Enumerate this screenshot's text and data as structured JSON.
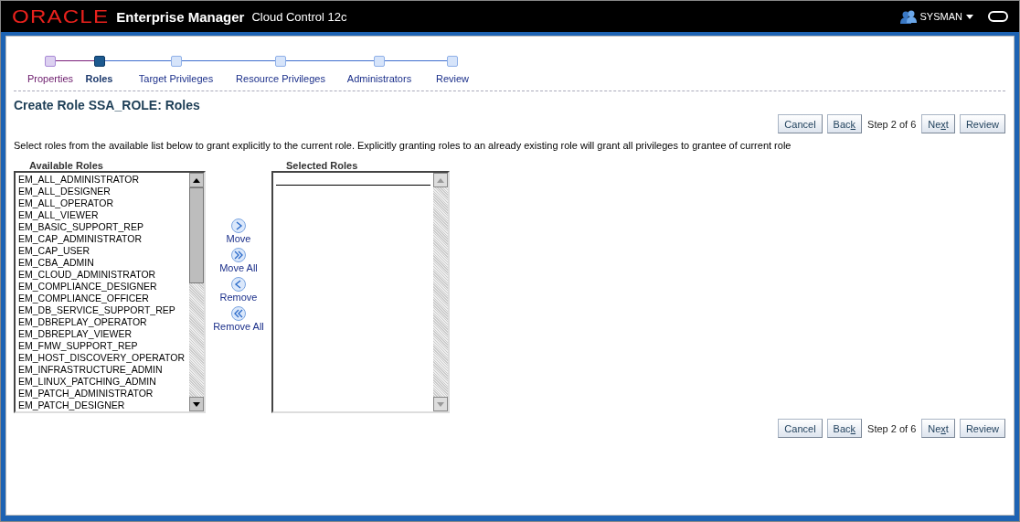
{
  "header": {
    "brand": "ORACLE",
    "product": "Enterprise Manager",
    "edition": "Cloud Control 12c",
    "user": "SYSMAN"
  },
  "train": [
    {
      "label": "Properties",
      "visited": true,
      "selected": false
    },
    {
      "label": "Roles",
      "visited": false,
      "selected": true
    },
    {
      "label": "Target Privileges",
      "visited": false,
      "selected": false
    },
    {
      "label": "Resource Privileges",
      "visited": false,
      "selected": false
    },
    {
      "label": "Administrators",
      "visited": false,
      "selected": false
    },
    {
      "label": "Review",
      "visited": false,
      "selected": false
    }
  ],
  "page_title": "Create Role SSA_ROLE: Roles",
  "top_nav": {
    "buttons": [
      {
        "before": "Cancel"
      },
      {
        "before": "Bac",
        "key": "k"
      }
    ],
    "step": "Step 2 of 6",
    "next_buttons": [
      {
        "before": "Ne",
        "key": "x",
        "after": "t"
      },
      {
        "before": "Review"
      }
    ]
  },
  "instructions": "Select roles from the available list below to grant explicitly to the current role. Explicitly granting roles to an already existing role will grant all privileges to grantee of current role",
  "available": {
    "title": "Available Roles",
    "items": [
      "EM_ALL_ADMINISTRATOR",
      "EM_ALL_DESIGNER",
      "EM_ALL_OPERATOR",
      "EM_ALL_VIEWER",
      "EM_BASIC_SUPPORT_REP",
      "EM_CAP_ADMINISTRATOR",
      "EM_CAP_USER",
      "EM_CBA_ADMIN",
      "EM_CLOUD_ADMINISTRATOR",
      "EM_COMPLIANCE_DESIGNER",
      "EM_COMPLIANCE_OFFICER",
      "EM_DB_SERVICE_SUPPORT_REP",
      "EM_DBREPLAY_OPERATOR",
      "EM_DBREPLAY_VIEWER",
      "EM_FMW_SUPPORT_REP",
      "EM_HOST_DISCOVERY_OPERATOR",
      "EM_INFRASTRUCTURE_ADMIN",
      "EM_LINUX_PATCHING_ADMIN",
      "EM_PATCH_ADMINISTRATOR",
      "EM_PATCH_DESIGNER"
    ]
  },
  "shuttle": [
    {
      "label": "Move",
      "kind": "move"
    },
    {
      "label": "Move All",
      "kind": "move-all"
    },
    {
      "label": "Remove",
      "kind": "remove"
    },
    {
      "label": "Remove All",
      "kind": "remove-all"
    }
  ],
  "selected": {
    "title": "Selected Roles"
  },
  "bottom_nav": {
    "buttons": [
      {
        "before": "Cancel"
      },
      {
        "before": "Bac",
        "key": "k"
      }
    ],
    "step": "Step 2 of 6",
    "next_buttons": [
      {
        "before": "Ne",
        "key": "x",
        "after": "t"
      },
      {
        "before": "Review"
      }
    ]
  }
}
